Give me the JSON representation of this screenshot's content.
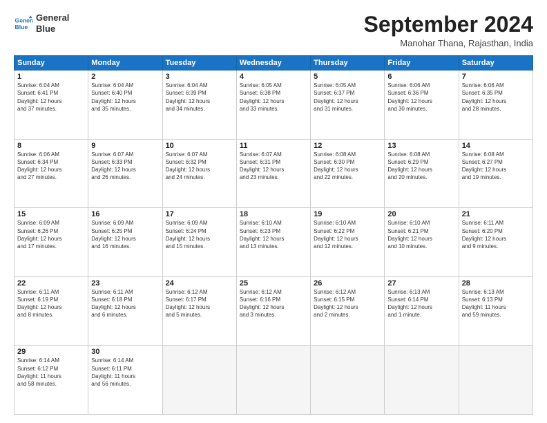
{
  "header": {
    "logo_line1": "General",
    "logo_line2": "Blue",
    "title": "September 2024",
    "subtitle": "Manohar Thana, Rajasthan, India"
  },
  "weekdays": [
    "Sunday",
    "Monday",
    "Tuesday",
    "Wednesday",
    "Thursday",
    "Friday",
    "Saturday"
  ],
  "weeks": [
    [
      {
        "day": "1",
        "info": "Sunrise: 6:04 AM\nSunset: 6:41 PM\nDaylight: 12 hours\nand 37 minutes."
      },
      {
        "day": "2",
        "info": "Sunrise: 6:04 AM\nSunset: 6:40 PM\nDaylight: 12 hours\nand 35 minutes."
      },
      {
        "day": "3",
        "info": "Sunrise: 6:04 AM\nSunset: 6:39 PM\nDaylight: 12 hours\nand 34 minutes."
      },
      {
        "day": "4",
        "info": "Sunrise: 6:05 AM\nSunset: 6:38 PM\nDaylight: 12 hours\nand 33 minutes."
      },
      {
        "day": "5",
        "info": "Sunrise: 6:05 AM\nSunset: 6:37 PM\nDaylight: 12 hours\nand 31 minutes."
      },
      {
        "day": "6",
        "info": "Sunrise: 6:06 AM\nSunset: 6:36 PM\nDaylight: 12 hours\nand 30 minutes."
      },
      {
        "day": "7",
        "info": "Sunrise: 6:06 AM\nSunset: 6:35 PM\nDaylight: 12 hours\nand 28 minutes."
      }
    ],
    [
      {
        "day": "8",
        "info": "Sunrise: 6:06 AM\nSunset: 6:34 PM\nDaylight: 12 hours\nand 27 minutes."
      },
      {
        "day": "9",
        "info": "Sunrise: 6:07 AM\nSunset: 6:33 PM\nDaylight: 12 hours\nand 26 minutes."
      },
      {
        "day": "10",
        "info": "Sunrise: 6:07 AM\nSunset: 6:32 PM\nDaylight: 12 hours\nand 24 minutes."
      },
      {
        "day": "11",
        "info": "Sunrise: 6:07 AM\nSunset: 6:31 PM\nDaylight: 12 hours\nand 23 minutes."
      },
      {
        "day": "12",
        "info": "Sunrise: 6:08 AM\nSunset: 6:30 PM\nDaylight: 12 hours\nand 22 minutes."
      },
      {
        "day": "13",
        "info": "Sunrise: 6:08 AM\nSunset: 6:29 PM\nDaylight: 12 hours\nand 20 minutes."
      },
      {
        "day": "14",
        "info": "Sunrise: 6:08 AM\nSunset: 6:27 PM\nDaylight: 12 hours\nand 19 minutes."
      }
    ],
    [
      {
        "day": "15",
        "info": "Sunrise: 6:09 AM\nSunset: 6:26 PM\nDaylight: 12 hours\nand 17 minutes."
      },
      {
        "day": "16",
        "info": "Sunrise: 6:09 AM\nSunset: 6:25 PM\nDaylight: 12 hours\nand 16 minutes."
      },
      {
        "day": "17",
        "info": "Sunrise: 6:09 AM\nSunset: 6:24 PM\nDaylight: 12 hours\nand 15 minutes."
      },
      {
        "day": "18",
        "info": "Sunrise: 6:10 AM\nSunset: 6:23 PM\nDaylight: 12 hours\nand 13 minutes."
      },
      {
        "day": "19",
        "info": "Sunrise: 6:10 AM\nSunset: 6:22 PM\nDaylight: 12 hours\nand 12 minutes."
      },
      {
        "day": "20",
        "info": "Sunrise: 6:10 AM\nSunset: 6:21 PM\nDaylight: 12 hours\nand 10 minutes."
      },
      {
        "day": "21",
        "info": "Sunrise: 6:11 AM\nSunset: 6:20 PM\nDaylight: 12 hours\nand 9 minutes."
      }
    ],
    [
      {
        "day": "22",
        "info": "Sunrise: 6:11 AM\nSunset: 6:19 PM\nDaylight: 12 hours\nand 8 minutes."
      },
      {
        "day": "23",
        "info": "Sunrise: 6:11 AM\nSunset: 6:18 PM\nDaylight: 12 hours\nand 6 minutes."
      },
      {
        "day": "24",
        "info": "Sunrise: 6:12 AM\nSunset: 6:17 PM\nDaylight: 12 hours\nand 5 minutes."
      },
      {
        "day": "25",
        "info": "Sunrise: 6:12 AM\nSunset: 6:16 PM\nDaylight: 12 hours\nand 3 minutes."
      },
      {
        "day": "26",
        "info": "Sunrise: 6:12 AM\nSunset: 6:15 PM\nDaylight: 12 hours\nand 2 minutes."
      },
      {
        "day": "27",
        "info": "Sunrise: 6:13 AM\nSunset: 6:14 PM\nDaylight: 12 hours\nand 1 minute."
      },
      {
        "day": "28",
        "info": "Sunrise: 6:13 AM\nSunset: 6:13 PM\nDaylight: 11 hours\nand 59 minutes."
      }
    ],
    [
      {
        "day": "29",
        "info": "Sunrise: 6:14 AM\nSunset: 6:12 PM\nDaylight: 11 hours\nand 58 minutes."
      },
      {
        "day": "30",
        "info": "Sunrise: 6:14 AM\nSunset: 6:11 PM\nDaylight: 11 hours\nand 56 minutes."
      },
      {
        "day": "",
        "info": ""
      },
      {
        "day": "",
        "info": ""
      },
      {
        "day": "",
        "info": ""
      },
      {
        "day": "",
        "info": ""
      },
      {
        "day": "",
        "info": ""
      }
    ]
  ]
}
